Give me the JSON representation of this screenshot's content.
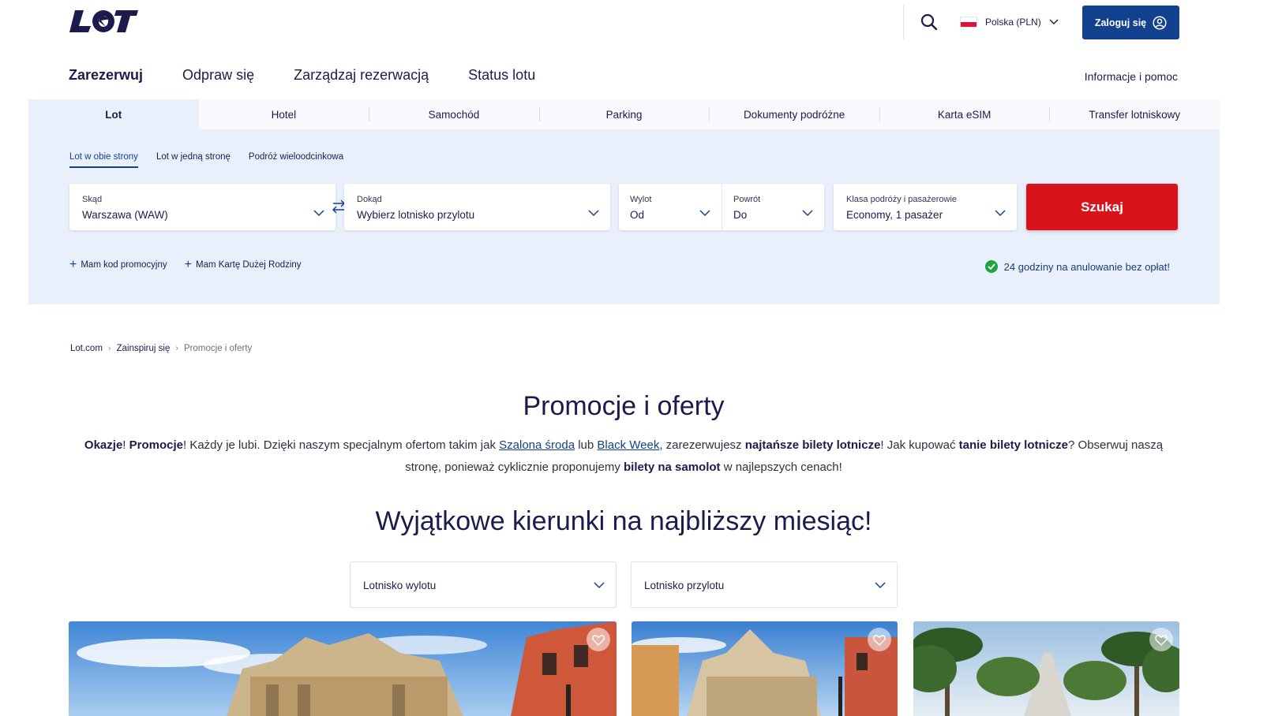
{
  "header": {
    "logo_text": "LOT",
    "language_label": "Polska (PLN)",
    "login_label": "Zaloguj się"
  },
  "nav": {
    "items": [
      "Zarezerwuj",
      "Odpraw się",
      "Zarządzaj rezerwacją",
      "Status lotu"
    ],
    "help_label": "Informacje i pomoc"
  },
  "booking": {
    "tabs": [
      "Lot",
      "Hotel",
      "Samochód",
      "Parking",
      "Dokumenty podróżne",
      "Karta eSIM",
      "Transfer lotniskowy"
    ],
    "trip_types": [
      "Lot w obie strony",
      "Lot w jedną stronę",
      "Podróż wieloodcinkowa"
    ],
    "from": {
      "label": "Skąd",
      "value": "Warszawa (WAW)"
    },
    "to": {
      "label": "Dokąd",
      "value": "Wybierz lotnisko przylotu"
    },
    "departure": {
      "label": "Wylot",
      "value": "Od"
    },
    "return": {
      "label": "Powrót",
      "value": "Do"
    },
    "class": {
      "label": "Klasa podróży i pasażerowie",
      "value": "Economy, 1 pasażer"
    },
    "search_label": "Szukaj",
    "promo_label": "Mam kod promocyjny",
    "family_card_label": "Mam Kartę Dużej Rodziny",
    "cancel_note": "24 godziny na anulowanie bez opłat!"
  },
  "breadcrumb": [
    "Lot.com",
    "Zainspiruj się",
    "Promocje i oferty"
  ],
  "content": {
    "title": "Promocje i oferty",
    "intro": {
      "p1": "Okazje",
      "p2": "! ",
      "p3": "Promocje",
      "p4": "! Każdy je lubi. Dzięki naszym specjalnym ofertom takim jak ",
      "link1": "Szalona środa",
      "p5": " lub ",
      "link2": "Black Week",
      "p6": ", zarezerwujesz ",
      "p7": "najtańsze bilety lotnicze",
      "p8": "! Jak kupować ",
      "p9": "tanie bilety lotnicze",
      "p10": "? Obserwuj naszą stronę, ponieważ cyklicznie proponujemy ",
      "p11": "bilety na samolot",
      "p12": " w najlepszych cenach!"
    },
    "subtitle": "Wyjątkowe kierunki na najbliższy miesiąc!",
    "departure_airport_placeholder": "Lotnisko wylotu",
    "arrival_airport_placeholder": "Lotnisko przylotu"
  },
  "colors": {
    "brand_navy": "#11418f",
    "text_navy": "#1b1b4d",
    "search_red": "#d8131c",
    "panel_bg": "#e9f0fb",
    "success_green": "#1fa53d"
  },
  "icons": [
    "search-icon",
    "poland-flag-icon",
    "chevron-down-icon",
    "user-icon",
    "swap-icon",
    "plus-icon",
    "check-circle-icon",
    "heart-icon"
  ]
}
